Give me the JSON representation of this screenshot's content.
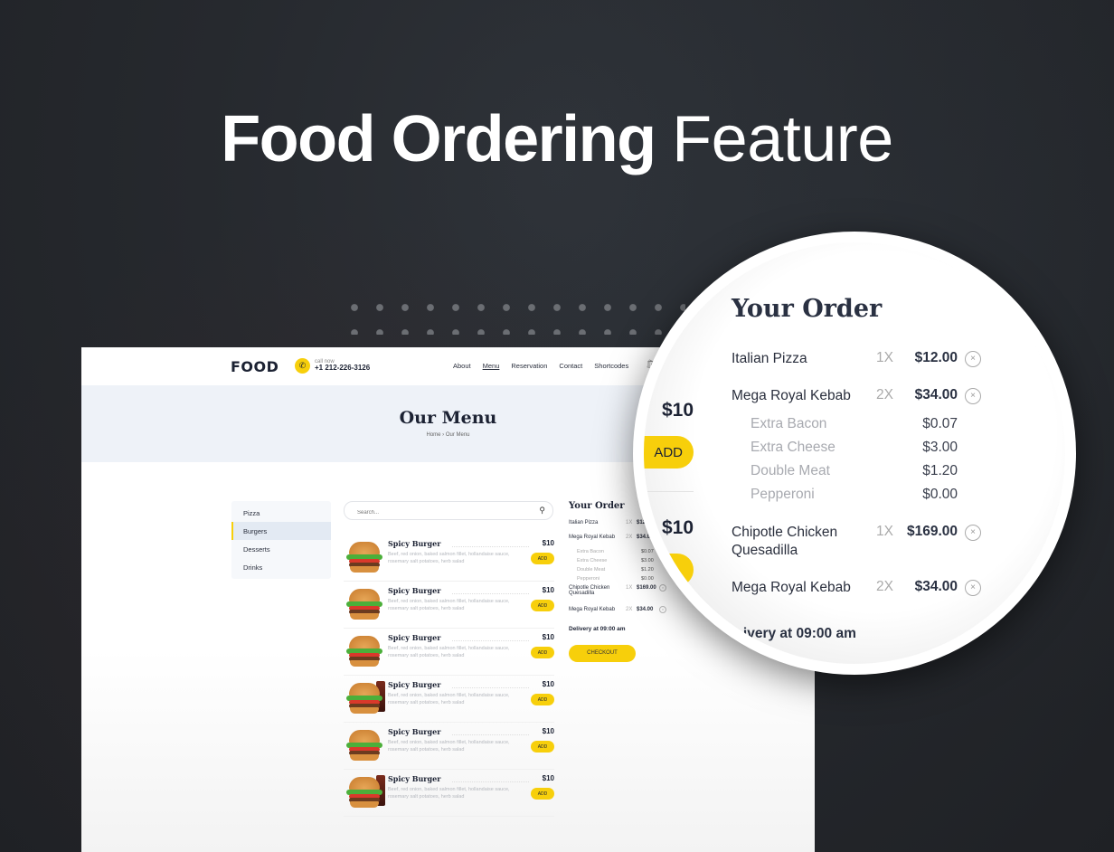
{
  "headline": {
    "bold": "Food Ordering",
    "light": "Feature"
  },
  "site": {
    "logo": "FOOD",
    "call_label": "call now",
    "phone": "+1 212-226-3126",
    "nav": [
      "About",
      "Menu",
      "Reservation",
      "Contact",
      "Shortcodes"
    ],
    "active_nav": "Menu"
  },
  "banner": {
    "title": "Our Menu",
    "breadcrumb": "Home › Our Menu"
  },
  "categories": [
    "Pizza",
    "Burgers",
    "Desserts",
    "Drinks"
  ],
  "active_category": "Burgers",
  "search": {
    "placeholder": "Search..."
  },
  "menu_items": [
    {
      "name": "Spicy Burger",
      "price": "$10",
      "desc": "Beef, red onion, baked salmon fillet, hollandaise sauce, rosemary salt potatoes, herb salad",
      "button": "ADD"
    },
    {
      "name": "Spicy Burger",
      "price": "$10",
      "desc": "Beef, red onion, baked salmon fillet, hollandaise sauce, rosemary salt potatoes, herb salad",
      "button": "ADD"
    },
    {
      "name": "Spicy Burger",
      "price": "$10",
      "desc": "Beef, red onion, baked salmon fillet, hollandaise sauce, rosemary salt potatoes, herb salad",
      "button": "ADD"
    },
    {
      "name": "Spicy Burger",
      "price": "$10",
      "desc": "Beef, red onion, baked salmon fillet, hollandaise sauce, rosemary salt potatoes, herb salad",
      "button": "ADD"
    },
    {
      "name": "Spicy Burger",
      "price": "$10",
      "desc": "Beef, red onion, baked salmon fillet, hollandaise sauce, rosemary salt potatoes, herb salad",
      "button": "ADD"
    },
    {
      "name": "Spicy Burger",
      "price": "$10",
      "desc": "Beef, red onion, baked salmon fillet, hollandaise sauce, rosemary salt potatoes, herb salad",
      "button": "ADD"
    }
  ],
  "order": {
    "title": "Your Order",
    "items": [
      {
        "name": "Italian Pizza",
        "qty": "1X",
        "price": "$12.00"
      },
      {
        "name": "Mega Royal Kebab",
        "qty": "2X",
        "price": "$34.00",
        "extras": [
          {
            "name": "Extra Bacon",
            "price": "$0.07"
          },
          {
            "name": "Extra Cheese",
            "price": "$3.00"
          },
          {
            "name": "Double Meat",
            "price": "$1.20"
          },
          {
            "name": "Pepperoni",
            "price": "$0.00"
          }
        ]
      },
      {
        "name": "Chipotle Chicken Quesadilla",
        "qty": "1X",
        "price": "$169.00"
      },
      {
        "name": "Mega Royal Kebab",
        "qty": "2X",
        "price": "$34.00"
      }
    ],
    "delivery": "Delivery at 09:00 am",
    "delivery_cropped": "ivery at 09:00 am",
    "checkout": "CHECKOUT"
  },
  "magnifier_peek": {
    "price": "$10",
    "button": "ADD"
  },
  "colors": {
    "accent": "#f7cf0b",
    "dark": "#1c2233",
    "background": "#26292e"
  }
}
